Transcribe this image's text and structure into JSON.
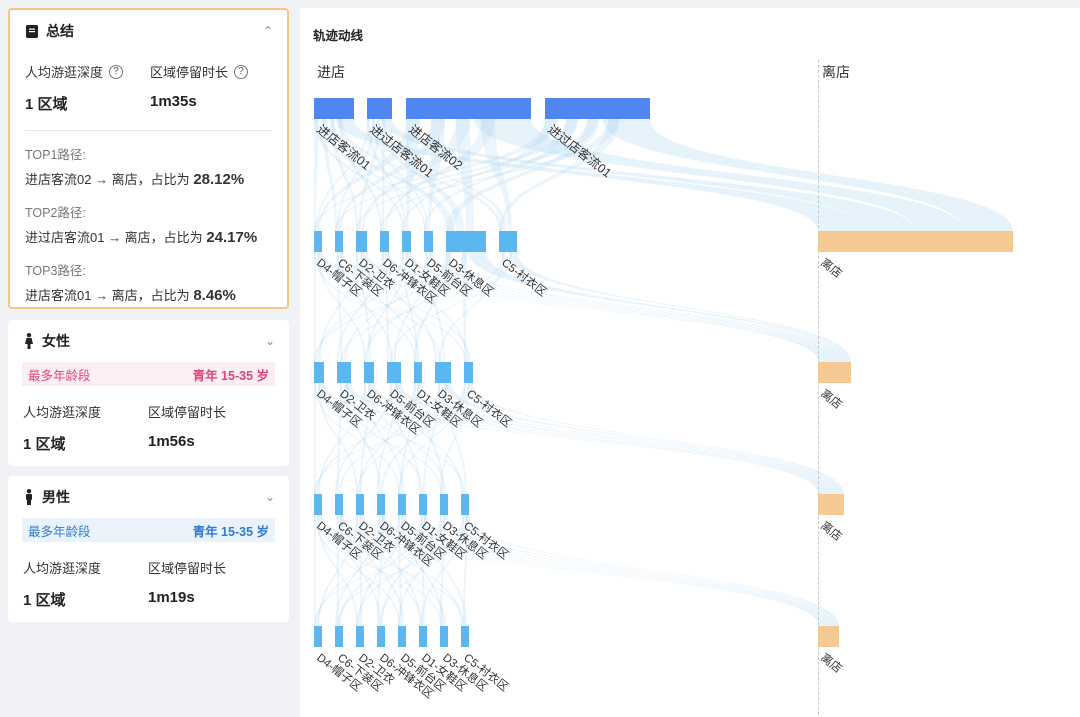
{
  "summary": {
    "title": "总结",
    "depth_label": "人均游逛深度",
    "dwell_label": "区域停留时长",
    "depth_value": "1 区域",
    "dwell_value": "1m35s",
    "tops": [
      {
        "label": "TOP1路径:",
        "path": "进店客流02 → 离店，占比为",
        "pct": "28.12%"
      },
      {
        "label": "TOP2路径:",
        "path": "进过店客流01 → 离店，占比为",
        "pct": "24.17%"
      },
      {
        "label": "TOP3路径:",
        "path": "进店客流01 → 离店，占比为",
        "pct": "8.46%"
      }
    ]
  },
  "female": {
    "title": "女性",
    "age_label": "最多年龄段",
    "age_value": "青年 15-35 岁",
    "depth_label": "人均游逛深度",
    "dwell_label": "区域停留时长",
    "depth_value": "1 区域",
    "dwell_value": "1m56s"
  },
  "male": {
    "title": "男性",
    "age_label": "最多年龄段",
    "age_value": "青年 15-35 岁",
    "depth_label": "人均游逛深度",
    "dwell_label": "区域停留时长",
    "depth_value": "1 区域",
    "dwell_value": "1m19s"
  },
  "chart_header": {
    "title": "轨迹动线",
    "enter": "进店",
    "leave": "离店"
  },
  "chart_data": {
    "type": "sankey",
    "colors": {
      "entry": "#4f86f0",
      "zone": "#5cb6f0",
      "exit": "#f5c994",
      "flow": "#a9d3f2"
    },
    "levels": [
      {
        "nodes": [
          {
            "name": "进店客流01",
            "w": 40
          },
          {
            "name": "进过店客流01",
            "w": 25
          },
          {
            "name": "进店客流02",
            "w": 125
          },
          {
            "name": "进过店客流01",
            "w": 105
          }
        ]
      },
      {
        "nodes": [
          {
            "name": "D4-帽子区",
            "w": 8
          },
          {
            "name": "C6-下装区",
            "w": 8
          },
          {
            "name": "D2-卫衣",
            "w": 11
          },
          {
            "name": "D6-冲锋衣区",
            "w": 9
          },
          {
            "name": "D1-女鞋区",
            "w": 9
          },
          {
            "name": "D5-前台区",
            "w": 9
          },
          {
            "name": "D3-休息区",
            "w": 40
          },
          {
            "name": "C5-衬衣区",
            "w": 18
          }
        ],
        "exit_w": 195
      },
      {
        "nodes": [
          {
            "name": "D4-帽子区",
            "w": 10
          },
          {
            "name": "D2-卫衣",
            "w": 14
          },
          {
            "name": "D6-冲锋衣区",
            "w": 10
          },
          {
            "name": "D5-前台区",
            "w": 14
          },
          {
            "name": "D1-女鞋区",
            "w": 8
          },
          {
            "name": "D3-休息区",
            "w": 16
          },
          {
            "name": "C5-衬衣区",
            "w": 9
          }
        ],
        "exit_w": 33
      },
      {
        "nodes": [
          {
            "name": "D4-帽子区",
            "w": 8
          },
          {
            "name": "C6-下装区",
            "w": 8
          },
          {
            "name": "D2-卫衣",
            "w": 8
          },
          {
            "name": "D6-冲锋衣区",
            "w": 8
          },
          {
            "name": "D5-前台区",
            "w": 8
          },
          {
            "name": "D1-女鞋区",
            "w": 8
          },
          {
            "name": "D3-休息区",
            "w": 8
          },
          {
            "name": "C5-衬衣区",
            "w": 8
          }
        ],
        "exit_w": 26
      },
      {
        "nodes": [
          {
            "name": "D4-帽子区",
            "w": 8
          },
          {
            "name": "C6-下装区",
            "w": 8
          },
          {
            "name": "D2-卫衣",
            "w": 8
          },
          {
            "name": "D6-冲锋衣区",
            "w": 8
          },
          {
            "name": "D5-前台区",
            "w": 8
          },
          {
            "name": "D1-女鞋区",
            "w": 8
          },
          {
            "name": "D3-休息区",
            "w": 8
          },
          {
            "name": "C5-衬衣区",
            "w": 8
          }
        ],
        "exit_w": 21
      }
    ],
    "exit_label": "离店"
  }
}
